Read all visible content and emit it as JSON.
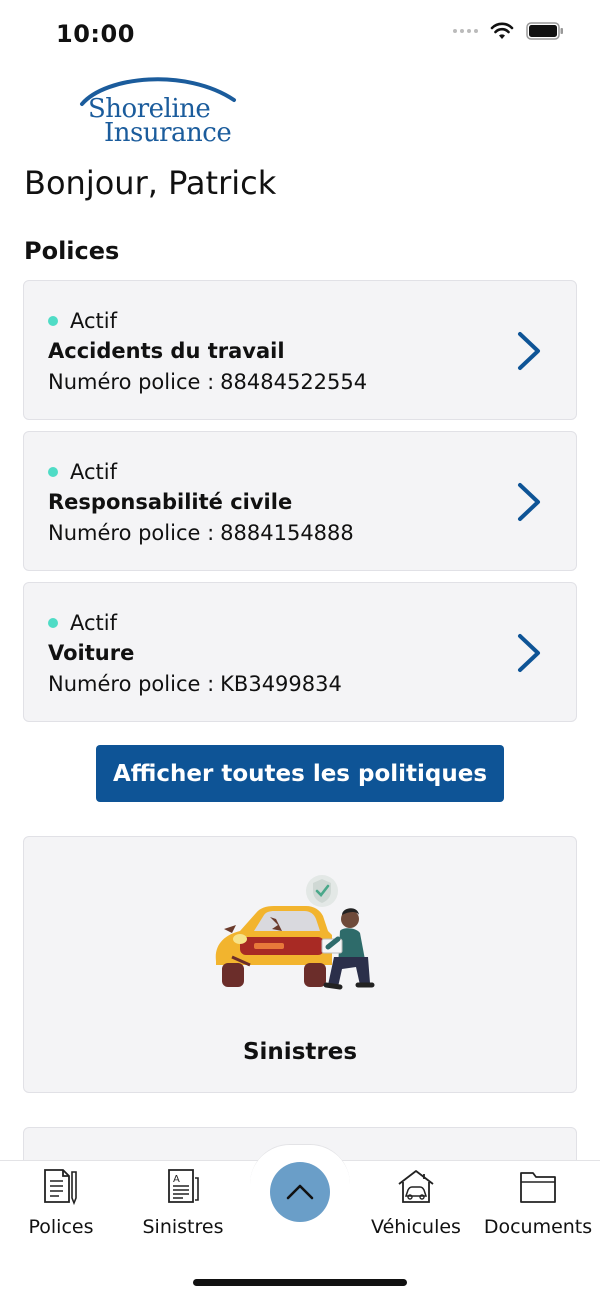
{
  "status_bar": {
    "time": "10:00"
  },
  "logo": {
    "line1": "Shoreline",
    "line2": "Insurance"
  },
  "greeting": "Bonjour, Patrick",
  "policies_section": {
    "title": "Polices",
    "items": [
      {
        "status": "Actif",
        "name": "Accidents du travail",
        "number_label": "Numéro police :",
        "number": "88484522554"
      },
      {
        "status": "Actif",
        "name": "Responsabilité civile",
        "number_label": "Numéro police :",
        "number": "8884154888"
      },
      {
        "status": "Actif",
        "name": "Voiture",
        "number_label": "Numéro police :",
        "number": "KB3499834"
      }
    ],
    "view_all_label": "Afficher toutes les politiques"
  },
  "claims_card": {
    "label": "Sinistres"
  },
  "bottom_nav": {
    "items": [
      {
        "label": "Polices",
        "icon": "policy-document-icon"
      },
      {
        "label": "Sinistres",
        "icon": "claims-document-icon"
      },
      {
        "label": "Véhicules",
        "icon": "vehicle-house-icon"
      },
      {
        "label": "Documents",
        "icon": "folder-icon"
      }
    ],
    "center_icon": "chevron-up-icon"
  },
  "colors": {
    "brand_blue": "#0e5496",
    "active_dot": "#4fdcc6",
    "card_bg": "#f4f4f6",
    "fab": "#6a9ec8"
  }
}
